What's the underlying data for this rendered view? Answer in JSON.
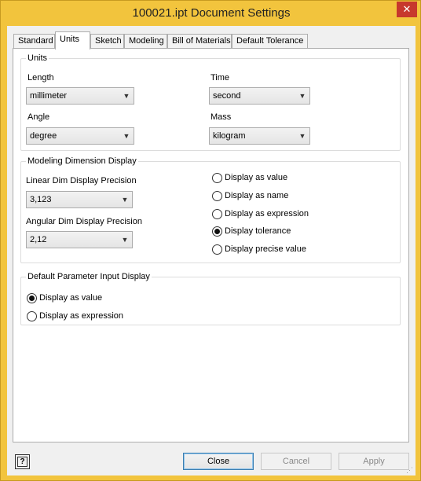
{
  "window": {
    "title": "100021.ipt Document Settings",
    "close_glyph": "✕"
  },
  "tabs": [
    {
      "label": "Standard"
    },
    {
      "label": "Units"
    },
    {
      "label": "Sketch"
    },
    {
      "label": "Modeling"
    },
    {
      "label": "Bill of Materials"
    },
    {
      "label": "Default Tolerance"
    }
  ],
  "active_tab": "Units",
  "units": {
    "legend": "Units",
    "length": {
      "label": "Length",
      "value": "millimeter"
    },
    "time": {
      "label": "Time",
      "value": "second"
    },
    "angle": {
      "label": "Angle",
      "value": "degree"
    },
    "mass": {
      "label": "Mass",
      "value": "kilogram"
    }
  },
  "modeling_dim": {
    "legend": "Modeling Dimension Display",
    "linear": {
      "label": "Linear Dim Display Precision",
      "value": "3,123"
    },
    "angular": {
      "label": "Angular Dim Display Precision",
      "value": "2,12"
    },
    "options": [
      {
        "label": "Display as value",
        "selected": false
      },
      {
        "label": "Display as name",
        "selected": false
      },
      {
        "label": "Display as expression",
        "selected": false
      },
      {
        "label": "Display tolerance",
        "selected": true
      },
      {
        "label": "Display precise value",
        "selected": false
      }
    ]
  },
  "param_input": {
    "legend": "Default Parameter Input Display",
    "options": [
      {
        "label": "Display as value",
        "selected": true
      },
      {
        "label": "Display as expression",
        "selected": false
      }
    ]
  },
  "buttons": {
    "close": "Close",
    "cancel": "Cancel",
    "apply": "Apply",
    "help_glyph": "?"
  },
  "colors": {
    "title_bar": "#f2c43d",
    "close_button": "#c7382d"
  }
}
